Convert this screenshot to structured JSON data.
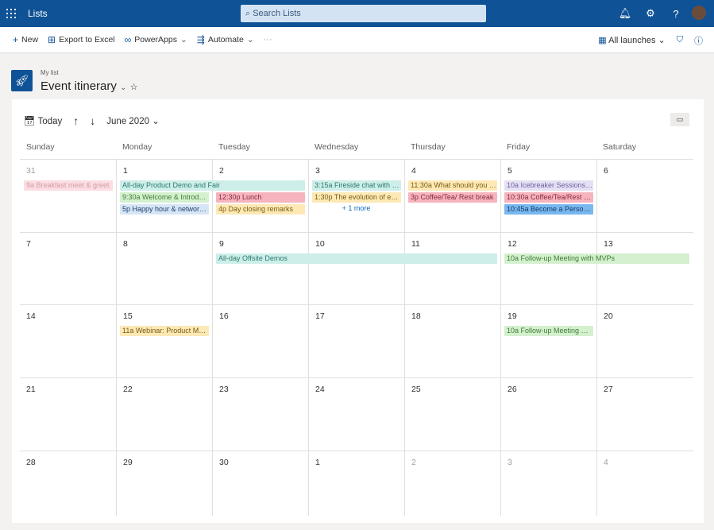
{
  "topbar": {
    "app": "Lists",
    "search_placeholder": "Search Lists",
    "icons": [
      "bell-icon",
      "gear-icon",
      "help-icon"
    ],
    "help": "?"
  },
  "commands": [
    {
      "icon": "+",
      "label": "New"
    },
    {
      "icon": "⊞",
      "label": "Export to Excel"
    },
    {
      "icon": "∞",
      "label": "PowerApps",
      "chevron": true
    },
    {
      "icon": "⇶",
      "label": "Automate",
      "chevron": true
    }
  ],
  "more": "···",
  "view": {
    "label": "All launches",
    "filter": "⛉",
    "info": "ⓘ"
  },
  "list": {
    "breadcrumb": "My list",
    "title": "Event itinerary"
  },
  "calendar": {
    "today": "Today",
    "month": "June 2020",
    "weekdays": [
      "Sunday",
      "Monday",
      "Tuesday",
      "Wednesday",
      "Thursday",
      "Friday",
      "Saturday"
    ],
    "weeks": [
      {
        "days": [
          "31",
          "1",
          "2",
          "3",
          "4",
          "5",
          "6"
        ],
        "other": [
          0
        ],
        "events": [
          {
            "start": 0,
            "end": 0,
            "text": "9a Breakfast meet & greet",
            "color": "pink"
          },
          {
            "start": 1,
            "end": 2,
            "text": "All-day Product Demo and Fair",
            "color": "teal"
          },
          {
            "start": 1,
            "end": 1,
            "text": "9:30a Welcome & Introducti...",
            "color": "green"
          },
          {
            "start": 1,
            "end": 1,
            "text": "5p Happy hour & networking",
            "color": "blue"
          },
          {
            "start": 2,
            "end": 2,
            "text": "12:30p Lunch",
            "color": "red"
          },
          {
            "start": 2,
            "end": 2,
            "text": "4p Day closing remarks",
            "color": "yellow"
          },
          {
            "start": 3,
            "end": 3,
            "text": "3:15a Fireside chat with Jason",
            "color": "teal"
          },
          {
            "start": 3,
            "end": 3,
            "text": "1:30p The evolution of emoj...",
            "color": "yellow"
          },
          {
            "start": 4,
            "end": 4,
            "text": "11:30a What should you bui...",
            "color": "yellow"
          },
          {
            "start": 4,
            "end": 4,
            "text": "3p Coffee/Tea/ Rest break",
            "color": "red"
          },
          {
            "start": 5,
            "end": 5,
            "text": "10a Icebreaker Sessions 1 - 4",
            "color": "lavender"
          },
          {
            "start": 5,
            "end": 5,
            "text": "10:30a Coffee/Tea/Rest break",
            "color": "red"
          },
          {
            "start": 5,
            "end": 5,
            "text": "10:45a Become a Person of...",
            "color": "strongblue"
          }
        ],
        "more": [
          {
            "day": 3,
            "text": "+ 1 more"
          }
        ]
      },
      {
        "days": [
          "7",
          "8",
          "9",
          "10",
          "11",
          "12",
          "13"
        ],
        "other": [],
        "events": [
          {
            "start": 2,
            "end": 4,
            "text": "All-day Offsite Demos",
            "color": "teal"
          },
          {
            "start": 5,
            "end": 6,
            "text": "10a Follow-up Meeting with MVPs",
            "color": "green"
          }
        ],
        "more": []
      },
      {
        "days": [
          "14",
          "15",
          "16",
          "17",
          "18",
          "19",
          "20"
        ],
        "other": [],
        "events": [
          {
            "start": 1,
            "end": 1,
            "text": "11a Webinar: Product Mana...",
            "color": "yellow"
          },
          {
            "start": 5,
            "end": 5,
            "text": "10a Follow-up Meeting with...",
            "color": "green"
          }
        ],
        "more": []
      },
      {
        "days": [
          "21",
          "22",
          "23",
          "24",
          "25",
          "26",
          "27"
        ],
        "other": [],
        "events": [],
        "more": []
      },
      {
        "days": [
          "28",
          "29",
          "30",
          "1",
          "2",
          "3",
          "4"
        ],
        "other": [
          4,
          5,
          6
        ],
        "events": [],
        "more": []
      }
    ]
  },
  "colors": {
    "pink": [
      "#fbdde2",
      "#d69ca5"
    ],
    "teal": [
      "#cdeee9",
      "#2b7a6f"
    ],
    "green": [
      "#d4f0cf",
      "#3f7d33"
    ],
    "blue": [
      "#d6e6f7",
      "#1f3f66"
    ],
    "red": [
      "#f6b4bf",
      "#8a2a3a"
    ],
    "yellow": [
      "#fde9b6",
      "#7a5b10"
    ],
    "lavender": [
      "#e6e0f5",
      "#6d63a0"
    ],
    "strongblue": [
      "#79b8ef",
      "#153a66"
    ]
  }
}
